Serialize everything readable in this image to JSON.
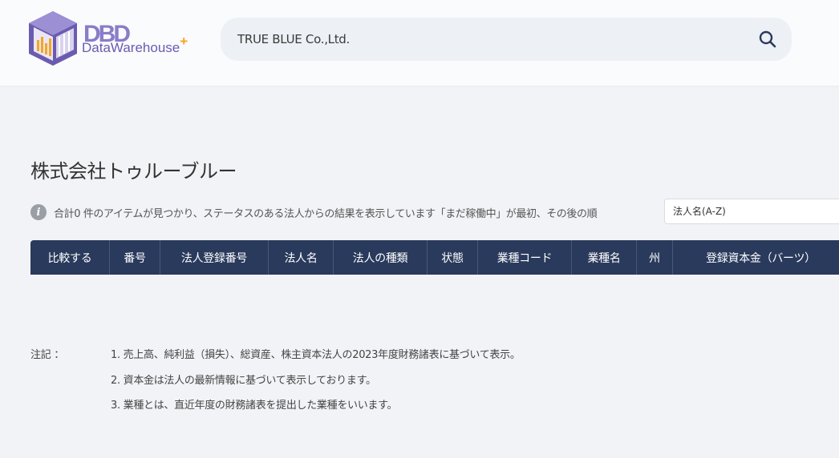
{
  "search": {
    "value": "TRUE BLUE Co.,Ltd."
  },
  "logo": {
    "letters": "DBD",
    "text_data": "Data",
    "text_warehouse": "Warehouse",
    "plus": "+"
  },
  "page": {
    "title": "株式会社トゥルーブルー"
  },
  "results": {
    "info_icon": "info-icon",
    "text": "合計0 件のアイテムが見つかり、ステータスのある法人からの結果を表示しています「まだ稼働中」が最初、その後の順",
    "sort_selected": "法人名(A-Z)"
  },
  "table": {
    "columns": [
      "比較する",
      "番号",
      "法人登録番号",
      "法人名",
      "法人の種類",
      "状態",
      "業種コード",
      "業種名",
      "州",
      "登録資本金（バーツ）"
    ]
  },
  "notes": {
    "label": "注記 ：",
    "items": [
      "1. 売上高、純利益（損失）、総資産、株主資本法人の2023年度財務諸表に基づいて表示。",
      "2. 資本金は法人の最新情報に基づいて表示しております。",
      "3. 業種とは、直近年度の財務諸表を提出した業種をいいます。"
    ]
  },
  "colors": {
    "header_bg": "#fafbfd",
    "table_head": "#2a3a5c",
    "logo_purple": "#6b5bb0",
    "logo_orange": "#f5a623"
  }
}
